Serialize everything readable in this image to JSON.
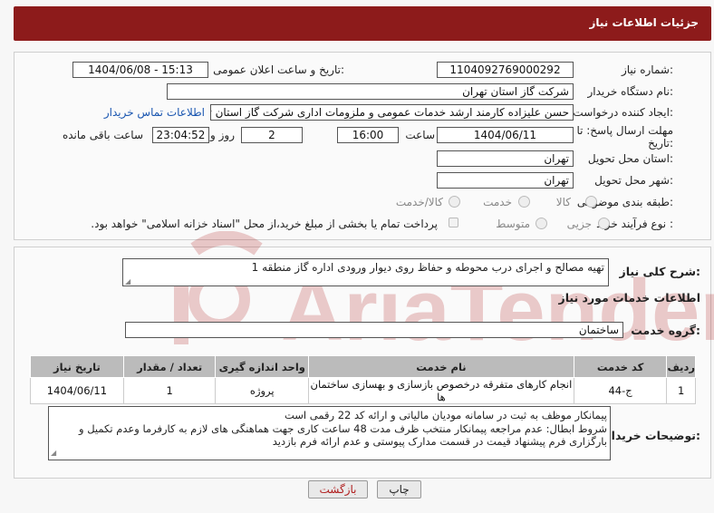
{
  "header": {
    "title": "جزئیات اطلاعات نیاز"
  },
  "info": {
    "need_number_label": "شماره نیاز:",
    "need_number": "1104092769000292",
    "announce_label": "تاریخ و ساعت اعلان عمومی:",
    "announce_value": "1404/06/08 - 15:13",
    "buyer_org_label": "نام دستگاه خریدار:",
    "buyer_org": "شرکت گاز استان تهران",
    "creator_label": "ایجاد کننده درخواست:",
    "creator": "حسن علیزاده کارمند ارشد خدمات عمومی و ملزومات اداری شرکت گاز استان تهران",
    "contact_link": "اطلاعات تماس خریدار",
    "deadline_label_line1": "مهلت ارسال پاسخ: تا",
    "deadline_label_line2": "تاریخ:",
    "deadline_date": "1404/06/11",
    "hour_label": "ساعت",
    "deadline_time": "16:00",
    "days_value": "2",
    "days_label": "روز و",
    "remaining_time": "23:04:52",
    "remaining_label": "ساعت باقی مانده",
    "province_label": "استان محل تحویل:",
    "province": "تهران",
    "city_label": "شهر محل تحویل:",
    "city": "تهران",
    "category_label": "طبقه بندی موضوعی:",
    "category_options": [
      "کالا",
      "خدمت",
      "کالا/خدمت"
    ],
    "process_label": "نوع فرآیند خرید :",
    "process_options": [
      "جزیی",
      "متوسط"
    ],
    "payment_note": "پرداخت تمام یا بخشی از مبلغ خرید،از محل \"اسناد خزانه اسلامی\" خواهد بود."
  },
  "summary": {
    "label": "شرح کلی نیاز:",
    "value": "تهیه مصالح و اجرای درب محوطه و حفاظ روی دیوار ورودی اداره گاز منطقه 1"
  },
  "services": {
    "section_title": "اطلاعات خدمات مورد نیاز",
    "group_label": "گروه خدمت:",
    "group_value": "ساختمان",
    "columns": [
      "ردیف",
      "کد خدمت",
      "نام خدمت",
      "واحد اندازه گیری",
      "تعداد / مقدار",
      "تاریخ نیاز"
    ],
    "rows": [
      {
        "row": "1",
        "code": "ج-44",
        "name": "انجام کارهای متفرقه درخصوص بازسازی و بهسازی ساختمان ها",
        "unit": "پروژه",
        "qty": "1",
        "date": "1404/06/11"
      }
    ]
  },
  "buyer_notes": {
    "label": "توضیحات خریدار:",
    "line1": "پیمانکار موظف به ثبت در سامانه مودیان مالیاتی و ارائه کد 22 رقمی است",
    "line2": "شروط ابطال: عدم مراجعه پیمانکار منتخب ظرف مدت 48 ساعت کاری جهت هماهنگی های لازم به کارفرما وعدم تکمیل و",
    "line3": "بارگزاری فرم پیشنهاد قیمت در قسمت مدارک پیوستی و عدم ارائه فرم بازدید"
  },
  "buttons": {
    "print": "چاپ",
    "back": "بازگشت"
  },
  "watermark": {
    "text": "AriaTender.neT"
  },
  "colors": {
    "header_bg": "#8d1b1b",
    "link": "#1a56b0",
    "table_header": "#bbbbbb"
  }
}
